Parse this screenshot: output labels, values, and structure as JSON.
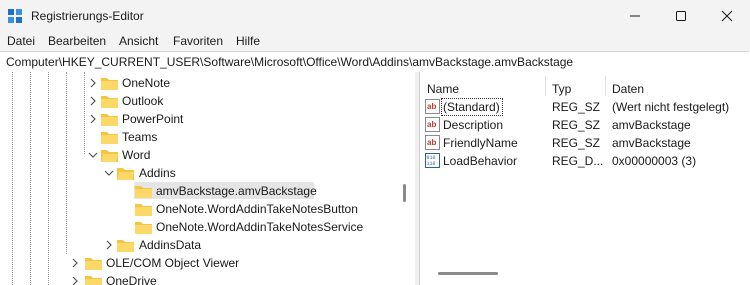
{
  "window": {
    "title": "Registrierungs-Editor",
    "icon": "regedit-icon"
  },
  "menu": [
    "Datei",
    "Bearbeiten",
    "Ansicht",
    "Favoriten",
    "Hilfe"
  ],
  "address": "Computer\\HKEY_CURRENT_USER\\Software\\Microsoft\\Office\\Word\\Addins\\amvBackstage.amvBackstage",
  "tree": [
    {
      "label": "OneNote",
      "expander": "collapsed"
    },
    {
      "label": "Outlook",
      "expander": "collapsed"
    },
    {
      "label": "PowerPoint",
      "expander": "collapsed"
    },
    {
      "label": "Teams",
      "expander": "none"
    },
    {
      "label": "Word",
      "expander": "expanded"
    },
    {
      "label": "Addins",
      "expander": "expanded"
    },
    {
      "label": "amvBackstage.amvBackstage",
      "expander": "none",
      "selected": true
    },
    {
      "label": "OneNote.WordAddinTakeNotesButton",
      "expander": "none"
    },
    {
      "label": "OneNote.WordAddinTakeNotesService",
      "expander": "none"
    },
    {
      "label": "AddinsData",
      "expander": "collapsed"
    },
    {
      "label": "OLE/COM Object Viewer",
      "expander": "collapsed"
    },
    {
      "label": "OneDrive",
      "expander": "collapsed"
    }
  ],
  "list": {
    "columns": [
      "Name",
      "Typ",
      "Daten"
    ],
    "rows": [
      {
        "name": "(Standard)",
        "type": "REG_SZ",
        "data": "(Wert nicht festgelegt)",
        "icon": "string-value-icon"
      },
      {
        "name": "Description",
        "type": "REG_SZ",
        "data": "amvBackstage",
        "icon": "string-value-icon"
      },
      {
        "name": "FriendlyName",
        "type": "REG_SZ",
        "data": "amvBackstage",
        "icon": "string-value-icon"
      },
      {
        "name": "LoadBehavior",
        "type": "REG_D...",
        "data": "0x00000003 (3)",
        "icon": "dword-value-icon"
      }
    ]
  },
  "colors": {
    "folder": "#f5c542",
    "selection": "#e5e5e5",
    "chrome": "#f3f3f3",
    "string_icon": "#c0392b",
    "dword_icon": "#2e5fa8"
  }
}
